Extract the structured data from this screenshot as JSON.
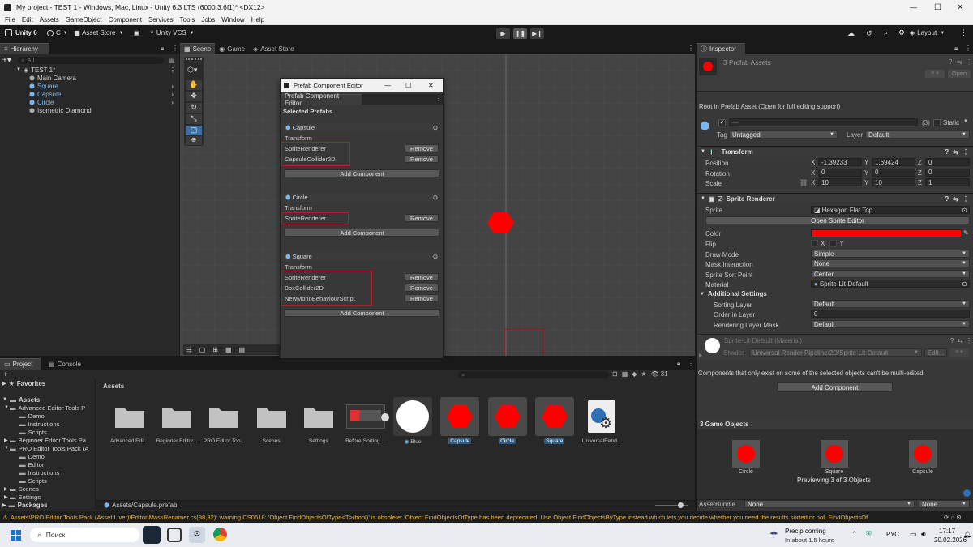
{
  "window": {
    "title": "My project - TEST 1 - Windows, Mac, Linux - Unity 6.3 LTS (6000.3.6f1)* <DX12>",
    "minimize": "—",
    "maximize": "☐",
    "close": "✕"
  },
  "menu": [
    "File",
    "Edit",
    "Assets",
    "GameObject",
    "Component",
    "Services",
    "Tools",
    "Jobs",
    "Window",
    "Help"
  ],
  "toolbar": {
    "unity_label": "Unity 6",
    "account": "C",
    "asset_store": "Asset Store",
    "vcs": "Unity VCS",
    "layout": "Layout"
  },
  "hierarchy": {
    "tab": "Hierarchy",
    "search_placeholder": "All",
    "scene": "TEST 1*",
    "items": [
      {
        "label": "Main Camera",
        "prefab": false,
        "arrow": false
      },
      {
        "label": "Square",
        "prefab": true,
        "arrow": true
      },
      {
        "label": "Capsule",
        "prefab": true,
        "arrow": true
      },
      {
        "label": "Circle",
        "prefab": true,
        "arrow": true
      },
      {
        "label": "Isometric Diamond",
        "prefab": false,
        "arrow": false
      }
    ]
  },
  "scene_tabs": [
    {
      "label": "Scene"
    },
    {
      "label": "Game"
    },
    {
      "label": "Asset Store"
    }
  ],
  "pce": {
    "window_title": "Prefab Component Editor",
    "tab": "Prefab Component Editor",
    "selected_prefabs": "Selected Prefabs",
    "groups": [
      {
        "name": "Capsule",
        "transform": "Transform",
        "components": [
          "SpriteRenderer",
          "CapsuleCollider2D"
        ]
      },
      {
        "name": "Circle",
        "transform": "Transform",
        "components": [
          "SpriteRenderer"
        ]
      },
      {
        "name": "Square",
        "transform": "Transform",
        "components": [
          "SpriteRenderer",
          "BoxCollider2D",
          "NewMonoBehaviourScript"
        ]
      }
    ],
    "remove": "Remove",
    "add_component": "Add Component"
  },
  "project": {
    "tab_project": "Project",
    "tab_console": "Console",
    "favorites": "Favorites",
    "assets": "Assets",
    "packages": "Packages",
    "tree": [
      "Advanced Editor Tools P",
      "Demo",
      "Instructions",
      "Scripts",
      "Beginner Editor Tools Pa",
      "PRO Editor Tools Pack (A",
      "Demo",
      "Editor",
      "Instructions",
      "Scripts",
      "Scenes",
      "Settings"
    ],
    "breadcrumb": "Assets",
    "path": "Assets/Capsule.prefab",
    "visible_count": "31",
    "items": [
      {
        "label": "Advanced Edit...",
        "kind": "folder"
      },
      {
        "label": "Beginner Editor...",
        "kind": "folder"
      },
      {
        "label": "PRO Editor Too...",
        "kind": "folder"
      },
      {
        "label": "Scenes",
        "kind": "folder"
      },
      {
        "label": "Settings",
        "kind": "folder"
      },
      {
        "label": "Before(Sorting ...",
        "kind": "image"
      },
      {
        "label": "Blue",
        "kind": "material"
      },
      {
        "label": "Capsule",
        "kind": "prefab"
      },
      {
        "label": "Circle",
        "kind": "prefab"
      },
      {
        "label": "Square",
        "kind": "prefab"
      },
      {
        "label": "UniversalRend...",
        "kind": "settings"
      }
    ]
  },
  "inspector": {
    "tab": "Inspector",
    "title": "3 Prefab Assets",
    "open": "Open",
    "root_info": "Root in Prefab Asset (Open for full editing support)",
    "name_placeholder": "—",
    "count": "(3)",
    "static": "Static",
    "tag_label": "Tag",
    "tag": "Untagged",
    "layer_label": "Layer",
    "layer": "Default",
    "transform": {
      "title": "Transform",
      "position": {
        "label": "Position",
        "x": "-1.39233",
        "y": "1.69424",
        "z": "0"
      },
      "rotation": {
        "label": "Rotation",
        "x": "0",
        "y": "0",
        "z": "0"
      },
      "scale": {
        "label": "Scale",
        "x": "10",
        "y": "10",
        "z": "1"
      }
    },
    "sprite_renderer": {
      "title": "Sprite Renderer",
      "sprite_label": "Sprite",
      "sprite": "Hexagon Flat Top",
      "open_sprite_editor": "Open Sprite Editor",
      "color_label": "Color",
      "color": "#ff0000",
      "flip_label": "Flip",
      "flip_x": "X",
      "flip_y": "Y",
      "draw_mode_label": "Draw Mode",
      "draw_mode": "Simple",
      "mask_label": "Mask Interaction",
      "mask": "None",
      "sort_point_label": "Sprite Sort Point",
      "sort_point": "Center",
      "material_label": "Material",
      "material": "Sprite-Lit-Default",
      "additional": "Additional Settings",
      "sorting_layer_label": "Sorting Layer",
      "sorting_layer": "Default",
      "order_label": "Order in Layer",
      "order": "0",
      "rlm_label": "Rendering Layer Mask",
      "rlm": "Default"
    },
    "material_block": {
      "title": "Sprite-Lit-Default (Material)",
      "shader_label": "Shader",
      "shader": "Universal Render Pipeline/2D/Sprite-Lit-Default",
      "edit": "Edit..."
    },
    "multi_note": "Components that only exist on some of the selected objects can't be multi-edited.",
    "add_component": "Add Component",
    "game_objects_title": "3 Game Objects",
    "previews": [
      "Circle",
      "Square",
      "Capsule"
    ],
    "previewing": "Previewing 3 of 3 Objects",
    "assetbundle_label": "AssetBundle",
    "assetbundle": "None",
    "assetbundle_variant": "None"
  },
  "status": {
    "warning": "Assets\\PRO Editor Tools Pack (Asset Liver)\\Editor\\MassRenamer.cs(98,32): warning CS0618: 'Object.FindObjectsOfType<T>(bool)' is obsolete: 'Object.FindObjectsOfType has been deprecated. Use Object.FindObjectsByType instead which lets you decide whether you need the results sorted or not.  FindObjectsOf"
  },
  "taskbar": {
    "search": "Поиск",
    "weather_title": "Precip coming",
    "weather_sub": "In about 1.5 hours",
    "lang": "РУС",
    "time": "17:17",
    "date": "20.02.2026"
  },
  "colors": {
    "accent_red": "#ff0000",
    "annotation_red": "#b01e26",
    "selection_blue": "#2c5d87"
  }
}
